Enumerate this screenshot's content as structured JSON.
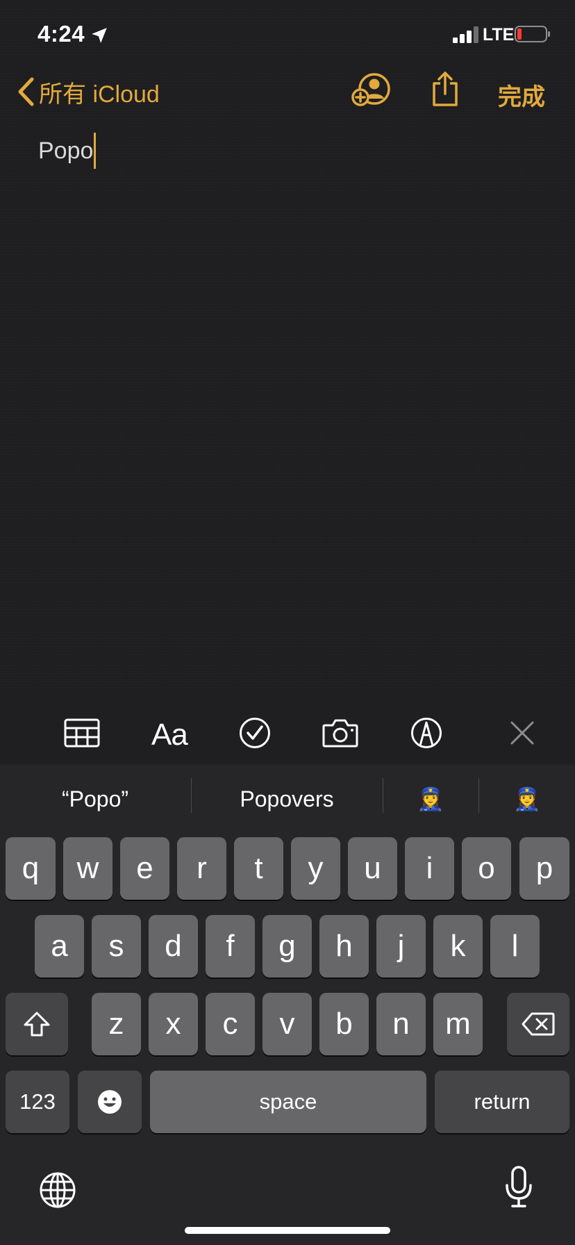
{
  "status": {
    "time": "4:24",
    "network": "LTE"
  },
  "nav": {
    "back_label": "所有 iCloud",
    "done_label": "完成"
  },
  "note": {
    "text": "Popo"
  },
  "toolbar": {
    "format_label": "Aa"
  },
  "suggestions": [
    "“Popo”",
    "Popovers",
    "👮‍♀️",
    "👮‍♀️"
  ],
  "keys": {
    "row1": [
      "q",
      "w",
      "e",
      "r",
      "t",
      "y",
      "u",
      "i",
      "o",
      "p"
    ],
    "row2": [
      "a",
      "s",
      "d",
      "f",
      "g",
      "h",
      "j",
      "k",
      "l"
    ],
    "row3": [
      "z",
      "x",
      "c",
      "v",
      "b",
      "n",
      "m"
    ],
    "numbers": "123",
    "space": "space",
    "return": "return"
  },
  "colors": {
    "accent": "#e2aa3d",
    "key": "#676769",
    "key_dark": "#454547"
  },
  "icons": [
    "location-arrow-icon",
    "signal-icon",
    "battery-icon",
    "chevron-left-icon",
    "add-person-icon",
    "share-icon",
    "table-icon",
    "checklist-icon",
    "camera-icon",
    "markup-icon",
    "close-icon",
    "shift-icon",
    "delete-icon",
    "emoji-icon",
    "globe-icon",
    "microphone-icon"
  ]
}
